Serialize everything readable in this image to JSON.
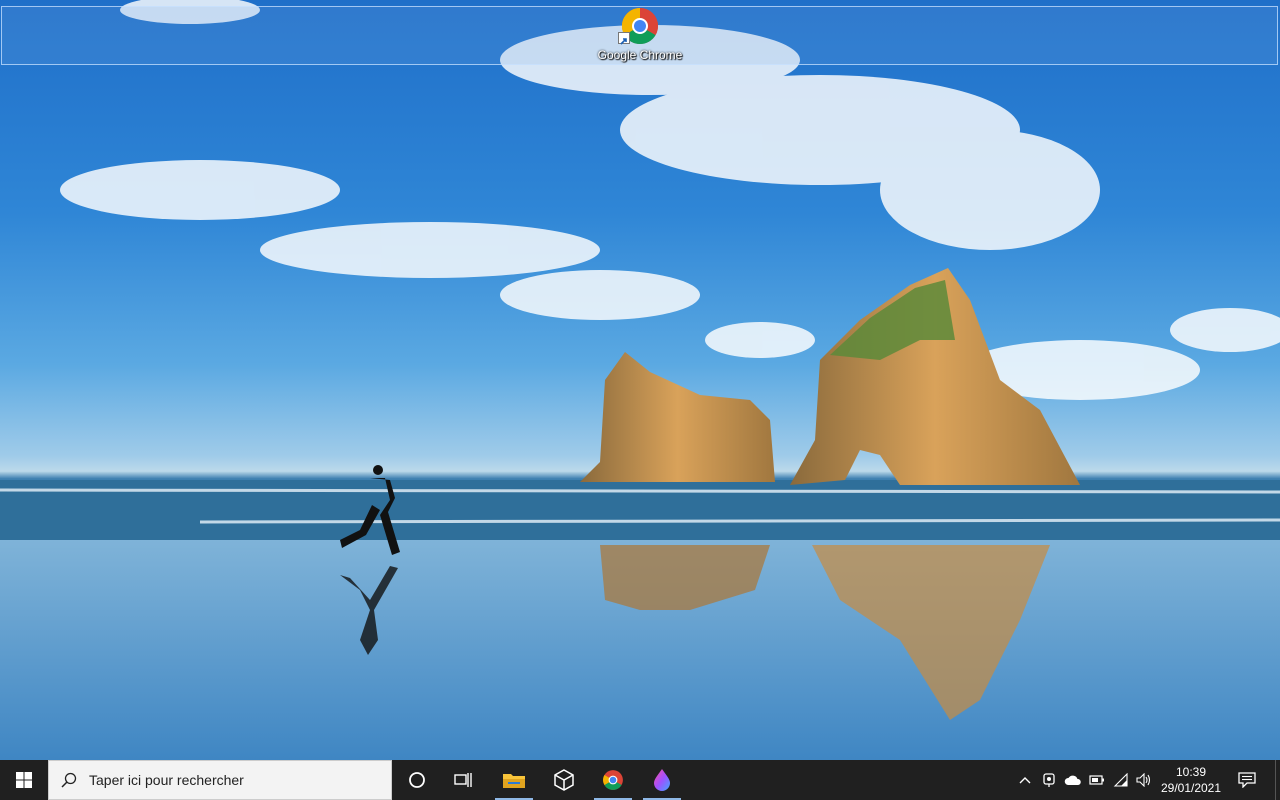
{
  "desktop": {
    "icons": [
      {
        "label": "Google Chrome",
        "icon": "chrome-icon"
      }
    ]
  },
  "taskbar": {
    "start_icon": "windows-logo-icon",
    "search_placeholder": "Taper ici pour rechercher",
    "search_icon": "search-icon",
    "cortana_icon": "cortana-circle-icon",
    "task_view_icon": "task-view-icon",
    "pinned": [
      {
        "name": "file-explorer",
        "icon": "folder-icon",
        "active": true
      },
      {
        "name": "3d-app",
        "icon": "cube-icon",
        "active": false
      },
      {
        "name": "chrome",
        "icon": "chrome-icon",
        "active": true
      },
      {
        "name": "paint-app",
        "icon": "drop-icon",
        "active": true
      }
    ],
    "tray": {
      "icons": [
        "chevron-up-icon",
        "meet-icon",
        "onedrive-icon",
        "battery-icon",
        "wifi-icon",
        "volume-icon"
      ],
      "time": "10:39",
      "date": "29/01/2021",
      "notifications_icon": "notification-icon"
    },
    "colors": {
      "background": "#202020",
      "search_bg": "#f3f3f3",
      "active_indicator": "#8fb8e6"
    }
  }
}
